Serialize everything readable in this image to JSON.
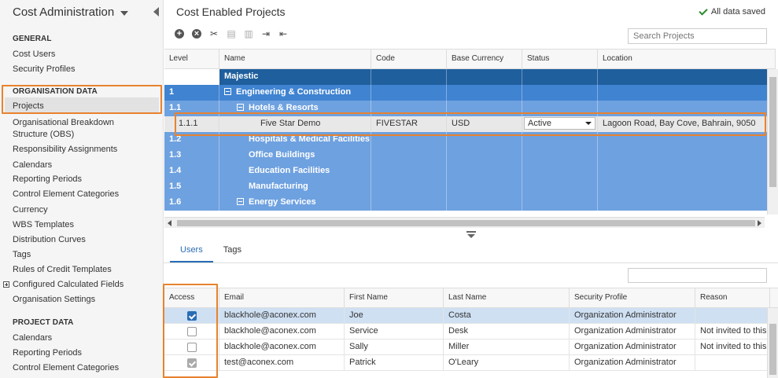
{
  "sidebar": {
    "app_title": "Cost Administration",
    "general_heading": "GENERAL",
    "general_items": [
      "Cost Users",
      "Security Profiles"
    ],
    "org_heading": "ORGANISATION DATA",
    "org_items": [
      "Projects",
      "Organisational Breakdown",
      "Structure (OBS)",
      "Responsibility Assignments",
      "Calendars",
      "Reporting Periods",
      "Control Element Categories",
      "Currency",
      "WBS Templates",
      "Distribution Curves",
      "Tags",
      "Rules of Credit Templates",
      "Configured Calculated Fields",
      "Organisation Settings"
    ],
    "project_heading": "PROJECT DATA",
    "project_items": [
      "Calendars",
      "Reporting Periods",
      "Control Element Categories"
    ]
  },
  "main": {
    "title": "Cost Enabled Projects",
    "saved_status": "All data saved",
    "search_placeholder": "Search Projects",
    "colors": {
      "accent": "#2a6db5",
      "level0": "#1f5f9e",
      "level1": "#3f83d1",
      "level2": "#6ea1e0",
      "highlight": "#e8822e",
      "success": "#2e8b2e"
    }
  },
  "projects_grid": {
    "columns": [
      "Level",
      "Name",
      "Code",
      "Base Currency",
      "Status",
      "Location"
    ],
    "rows": [
      {
        "level": "",
        "name": "Majestic",
        "code": "",
        "currency": "",
        "status": "",
        "location": ""
      },
      {
        "level": "1",
        "name": "Engineering & Construction",
        "code": "",
        "currency": "",
        "status": "",
        "location": ""
      },
      {
        "level": "1.1",
        "name": "Hotels & Resorts",
        "code": "",
        "currency": "",
        "status": "",
        "location": ""
      },
      {
        "level": "1.1.1",
        "name": "Five Star Demo",
        "code": "FIVESTAR",
        "currency": "USD",
        "status": "Active",
        "location": "Lagoon Road, Bay Cove, Bahrain, 9050"
      },
      {
        "level": "1.2",
        "name": "Hospitals & Medical Facilities",
        "code": "",
        "currency": "",
        "status": "",
        "location": ""
      },
      {
        "level": "1.3",
        "name": "Office Buildings",
        "code": "",
        "currency": "",
        "status": "",
        "location": ""
      },
      {
        "level": "1.4",
        "name": "Education Facilities",
        "code": "",
        "currency": "",
        "status": "",
        "location": ""
      },
      {
        "level": "1.5",
        "name": "Manufacturing",
        "code": "",
        "currency": "",
        "status": "",
        "location": ""
      },
      {
        "level": "1.6",
        "name": "Energy Services",
        "code": "",
        "currency": "",
        "status": "",
        "location": ""
      }
    ]
  },
  "tabs": [
    "Users",
    "Tags"
  ],
  "users_grid": {
    "columns": [
      "Access",
      "Email",
      "First Name",
      "Last Name",
      "Security Profile",
      "Reason"
    ],
    "rows": [
      {
        "access": "checked",
        "email": "blackhole@aconex.com",
        "first": "Joe",
        "last": "Costa",
        "profile": "Organization Administrator",
        "reason": ""
      },
      {
        "access": "unchecked",
        "email": "blackhole@aconex.com",
        "first": "Service",
        "last": "Desk",
        "profile": "Organization Administrator",
        "reason": "Not invited to this"
      },
      {
        "access": "unchecked",
        "email": "blackhole@aconex.com",
        "first": "Sally",
        "last": "Miller",
        "profile": "Organization Administrator",
        "reason": "Not invited to this"
      },
      {
        "access": "disabled-checked",
        "email": "test@aconex.com",
        "first": "Patrick",
        "last": "O'Leary",
        "profile": "Organization Administrator",
        "reason": ""
      }
    ]
  }
}
